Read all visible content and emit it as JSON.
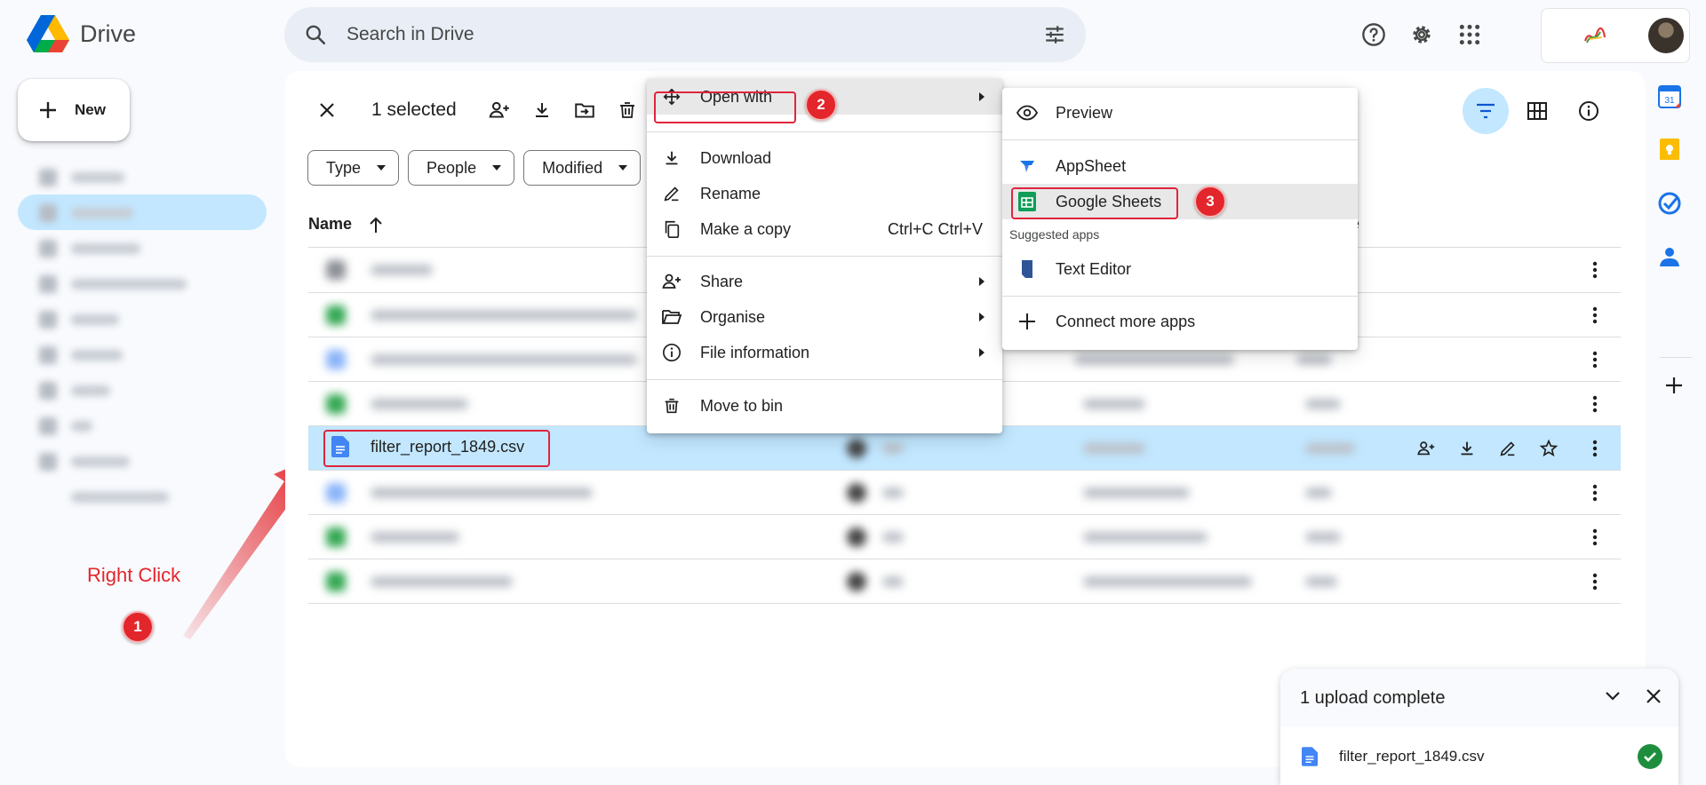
{
  "app": {
    "title": "Drive"
  },
  "search": {
    "placeholder": "Search in Drive"
  },
  "sidebar": {
    "new_label": "New",
    "items": [
      "Priority",
      "My Drive",
      "Shared drives",
      "Shared with me",
      "Recent",
      "Starred",
      "Spam",
      "Bin",
      "Storage"
    ]
  },
  "selection": {
    "count_label": "1 selected"
  },
  "filters": {
    "chips": [
      "Type",
      "People",
      "Modified"
    ]
  },
  "table": {
    "name_header": "Name",
    "size_header": "e",
    "selected_file": "filter_report_1849.csv"
  },
  "context_menu": {
    "items": [
      {
        "label": "Open with",
        "shortcut": "",
        "submenu": true
      },
      {
        "label": "Download",
        "shortcut": "",
        "submenu": false
      },
      {
        "label": "Rename",
        "shortcut": "",
        "submenu": false
      },
      {
        "label": "Make a copy",
        "shortcut": "Ctrl+C Ctrl+V",
        "submenu": false
      },
      {
        "label": "Share",
        "shortcut": "",
        "submenu": true
      },
      {
        "label": "Organise",
        "shortcut": "",
        "submenu": true
      },
      {
        "label": "File information",
        "shortcut": "",
        "submenu": true
      },
      {
        "label": "Move to bin",
        "shortcut": "",
        "submenu": false
      }
    ]
  },
  "open_with_menu": {
    "preview": "Preview",
    "appsheet": "AppSheet",
    "google_sheets": "Google Sheets",
    "suggested_label": "Suggested apps",
    "text_editor": "Text Editor",
    "connect_more": "Connect more apps"
  },
  "annotations": {
    "right_click": "Right Click",
    "step1": "1",
    "step2": "2",
    "step3": "3",
    "accent_color": "#e3262c"
  },
  "upload_toast": {
    "title": "1 upload complete",
    "file": "filter_report_1849.csv"
  }
}
